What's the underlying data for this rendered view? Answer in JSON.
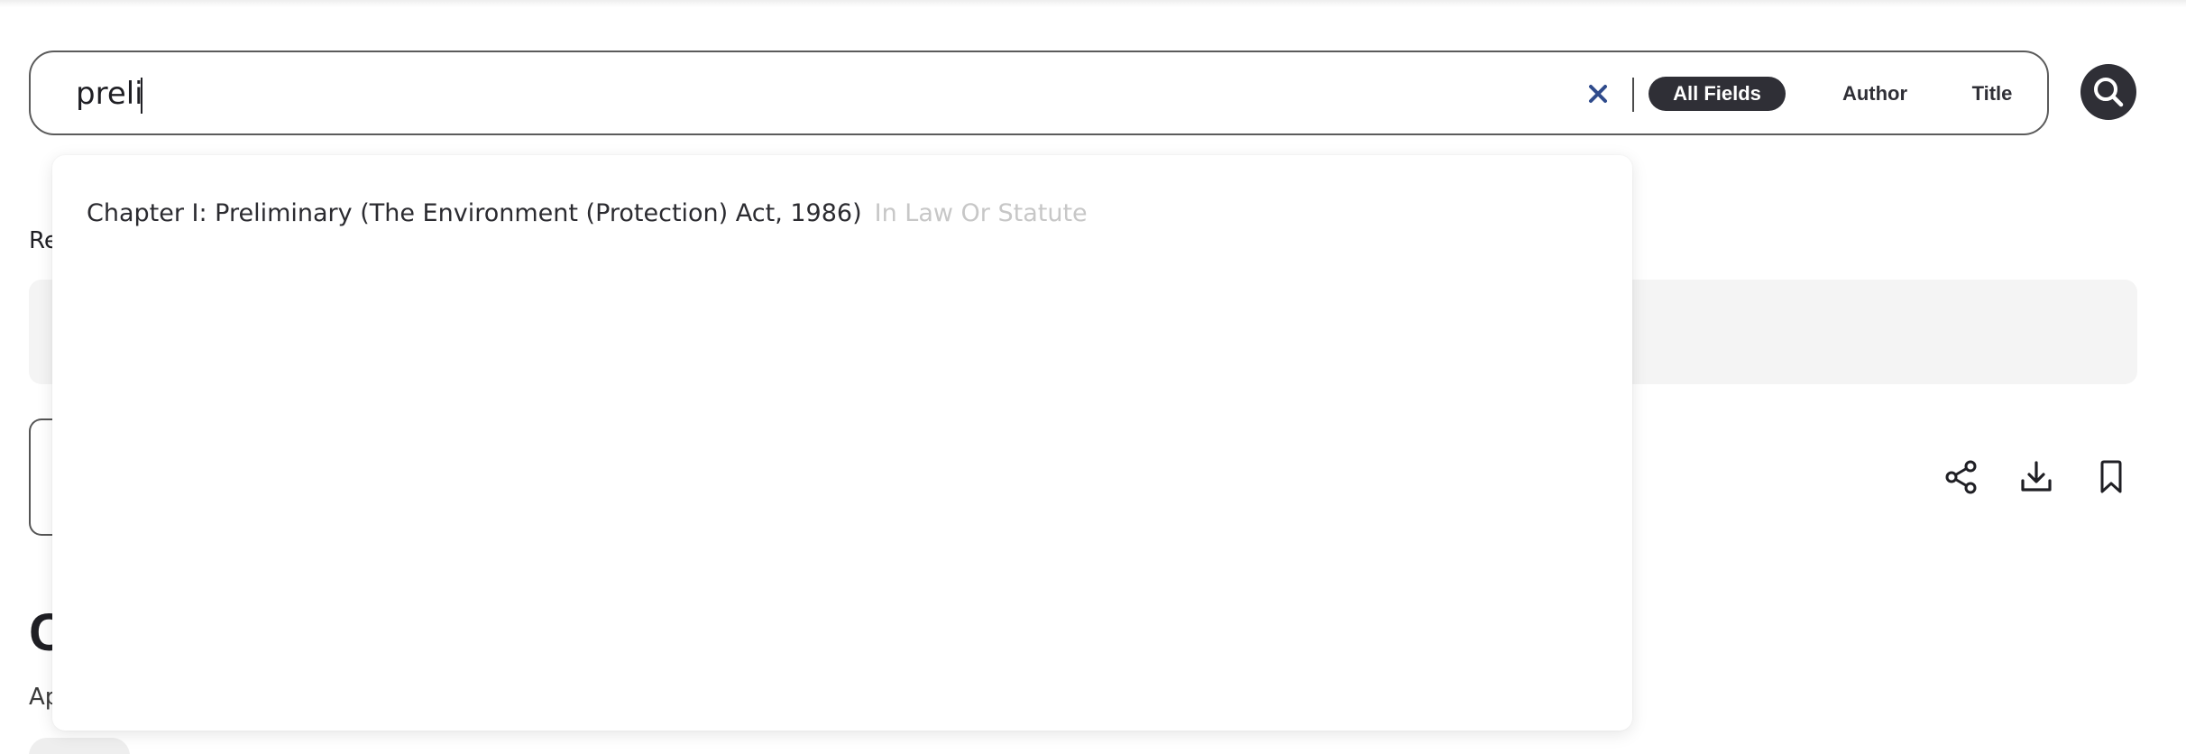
{
  "search": {
    "query": "preli",
    "field_tabs": [
      {
        "label": "All Fields",
        "active": true
      },
      {
        "label": "Author",
        "active": false
      },
      {
        "label": "Title",
        "active": false
      }
    ]
  },
  "suggestions": [
    {
      "title": "Chapter I: Preliminary (The Environment (Protection) Act, 1986)",
      "category": "In Law Or Statute"
    }
  ],
  "background": {
    "label_fragment": "Re",
    "heading_fragment": "C",
    "sub_fragment": "Ap"
  },
  "icons": {
    "clear": "close-icon",
    "search": "search-icon",
    "share": "share-icon",
    "download": "download-icon",
    "bookmark": "bookmark-icon"
  },
  "colors": {
    "dark": "#2f2f36",
    "clear_icon": "#2f4b8c",
    "muted_text": "#c7c7c7",
    "panel_bg": "#f4f4f4"
  }
}
